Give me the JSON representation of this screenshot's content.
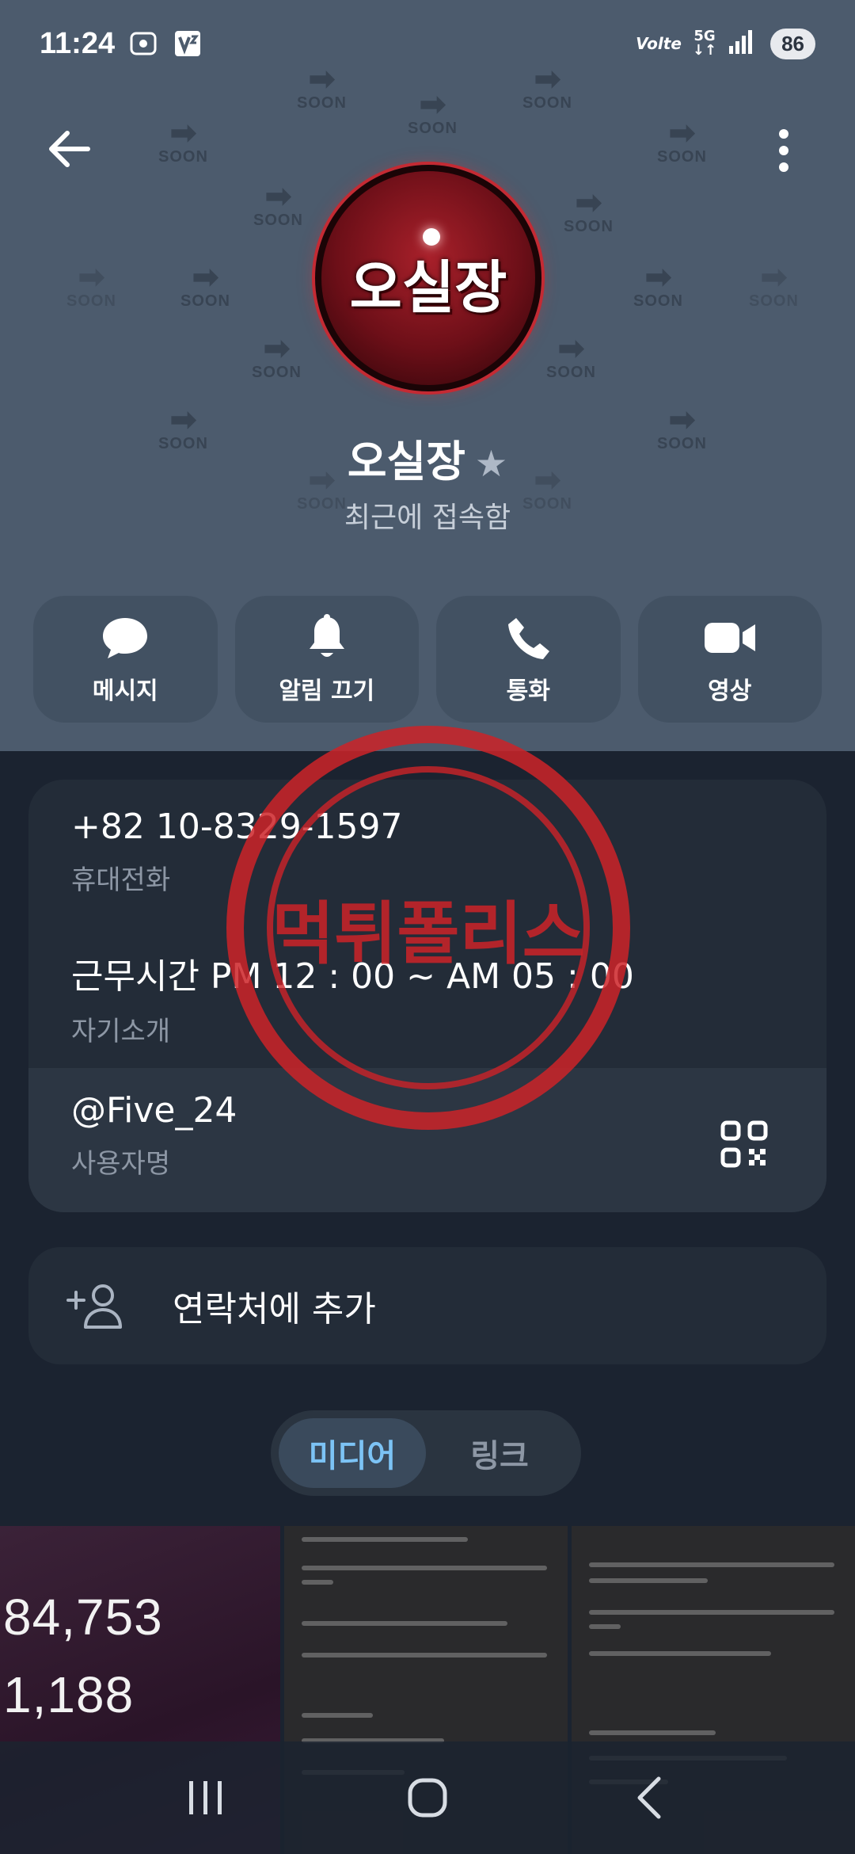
{
  "status_bar": {
    "time": "11:24",
    "network_label": "Volte",
    "network_type": "5G",
    "battery": "86"
  },
  "header": {
    "background_pattern_word": "SOON",
    "avatar_text": "오실장",
    "name": "오실장",
    "status": "최근에 접속함",
    "colors": {
      "header_bg": "#4c5b6d",
      "action_bg": "#425162"
    }
  },
  "actions": [
    {
      "label": "메시지",
      "icon": "chat-bubble-icon"
    },
    {
      "label": "알림 끄기",
      "icon": "bell-icon"
    },
    {
      "label": "통화",
      "icon": "phone-icon"
    },
    {
      "label": "영상",
      "icon": "video-camera-icon"
    }
  ],
  "info": {
    "phone": "+82 10-8329-1597",
    "phone_label": "휴대전화",
    "bio": "근무시간 PM 12 : 00 ~ AM 05 : 00",
    "bio_label": "자기소개",
    "username": "@Five_24",
    "username_label": "사용자명"
  },
  "stamp_text": "먹튀폴리스",
  "add_contact": {
    "label": "연락처에 추가"
  },
  "tabs": [
    {
      "label": "미디어",
      "active": true
    },
    {
      "label": "링크",
      "active": false
    }
  ],
  "media": {
    "thumb1_values": [
      "84,753",
      "1,188"
    ]
  }
}
